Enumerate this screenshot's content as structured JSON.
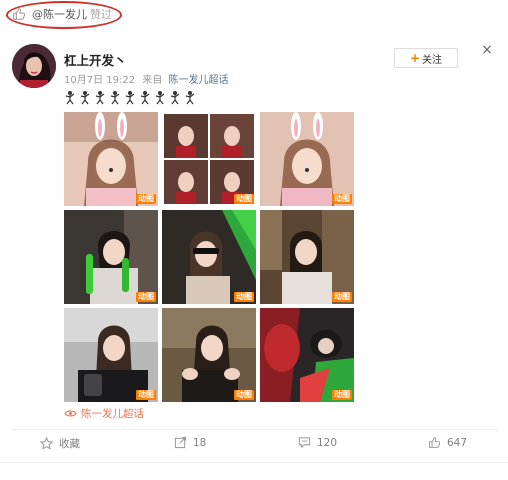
{
  "liked_bar": {
    "user": "@陈一发儿",
    "tag": "赞过"
  },
  "post": {
    "author": "杠上开发丶",
    "time": "10月7日 19:22",
    "from_label": "来自",
    "source": "陈一发儿超话",
    "follow_label": "关注",
    "close_symbol": "×",
    "emoji_count": 9
  },
  "images": [
    {
      "badge": "动图"
    },
    {
      "badge": "动图"
    },
    {
      "badge": "动图"
    },
    {
      "badge": "动图"
    },
    {
      "badge": "动图"
    },
    {
      "badge": "动图"
    },
    {
      "badge": "动图"
    },
    {
      "badge": "动图"
    },
    {
      "badge": "动图"
    }
  ],
  "topic": {
    "label": "陈一发儿超话"
  },
  "actions": {
    "favorite_label": "收藏",
    "repost_count": "18",
    "comment_count": "120",
    "like_count": "647"
  },
  "colors": {
    "accent": "#eb7350",
    "follow_plus": "#f08300",
    "gif_badge": "#ff7e00",
    "annotation": "#d0302a"
  }
}
